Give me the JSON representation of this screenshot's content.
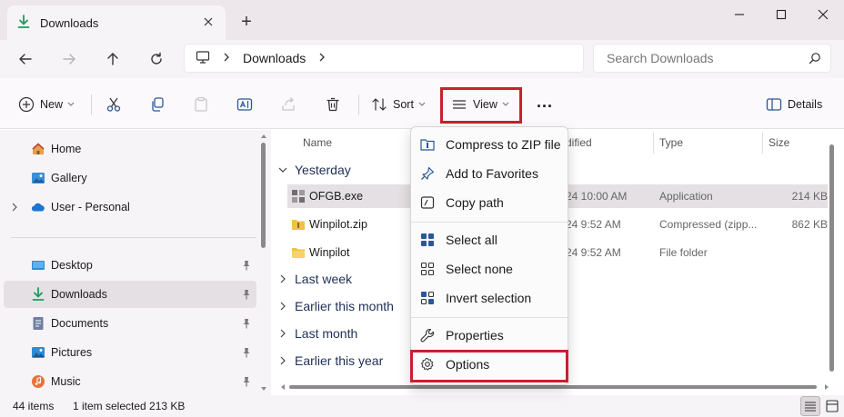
{
  "window": {
    "tab_title": "Downloads",
    "new_tab_symbol": "+",
    "controls": [
      "minimize-icon",
      "maximize-icon",
      "close-icon"
    ]
  },
  "address": {
    "crumb": "Downloads",
    "search_placeholder": "Search Downloads"
  },
  "toolbar": {
    "new_label": "New",
    "sort_label": "Sort",
    "view_label": "View",
    "more_label": "...",
    "details_label": "Details",
    "icons": [
      "cut-icon",
      "copy-icon",
      "paste-icon",
      "rename-icon",
      "share-icon",
      "delete-icon"
    ]
  },
  "sidebar": {
    "top": [
      {
        "label": "Home",
        "icon": "home-icon"
      },
      {
        "label": "Gallery",
        "icon": "gallery-icon"
      },
      {
        "label": "User - Personal",
        "icon": "onedrive-icon"
      }
    ],
    "quick": [
      {
        "label": "Desktop",
        "icon": "desktop-icon"
      },
      {
        "label": "Downloads",
        "icon": "download-icon",
        "selected": true
      },
      {
        "label": "Documents",
        "icon": "documents-icon"
      },
      {
        "label": "Pictures",
        "icon": "pictures-icon"
      },
      {
        "label": "Music",
        "icon": "music-icon"
      }
    ]
  },
  "columns": {
    "name": "Name",
    "modified": "dified",
    "type": "Type",
    "size": "Size"
  },
  "groups": {
    "yesterday": "Yesterday",
    "last_week": "Last week",
    "earlier_month": "Earlier this month",
    "last_month": "Last month",
    "earlier_year": "Earlier this year"
  },
  "files": [
    {
      "name": "OFGB.exe",
      "date": "24 10:00 AM",
      "type": "Application",
      "size": "214 KB",
      "selected": true
    },
    {
      "name": "Winpilot.zip",
      "date": "24 9:52 AM",
      "type": "Compressed (zipp...",
      "size": "862 KB"
    },
    {
      "name": "Winpilot",
      "date": "24 9:52 AM",
      "type": "File folder",
      "size": ""
    }
  ],
  "menu": {
    "compress": "Compress to ZIP file",
    "favorites": "Add to Favorites",
    "copy_path": "Copy path",
    "select_all": "Select all",
    "select_none": "Select none",
    "invert": "Invert selection",
    "properties": "Properties",
    "options": "Options"
  },
  "status": {
    "count": "44 items",
    "selection": "1 item selected  213 KB"
  },
  "colors": {
    "accent_download": "#1f9b5e",
    "highlight_red": "#c8202f",
    "folder": "#f2c14a",
    "selection_bg": "#e4e0e3"
  }
}
